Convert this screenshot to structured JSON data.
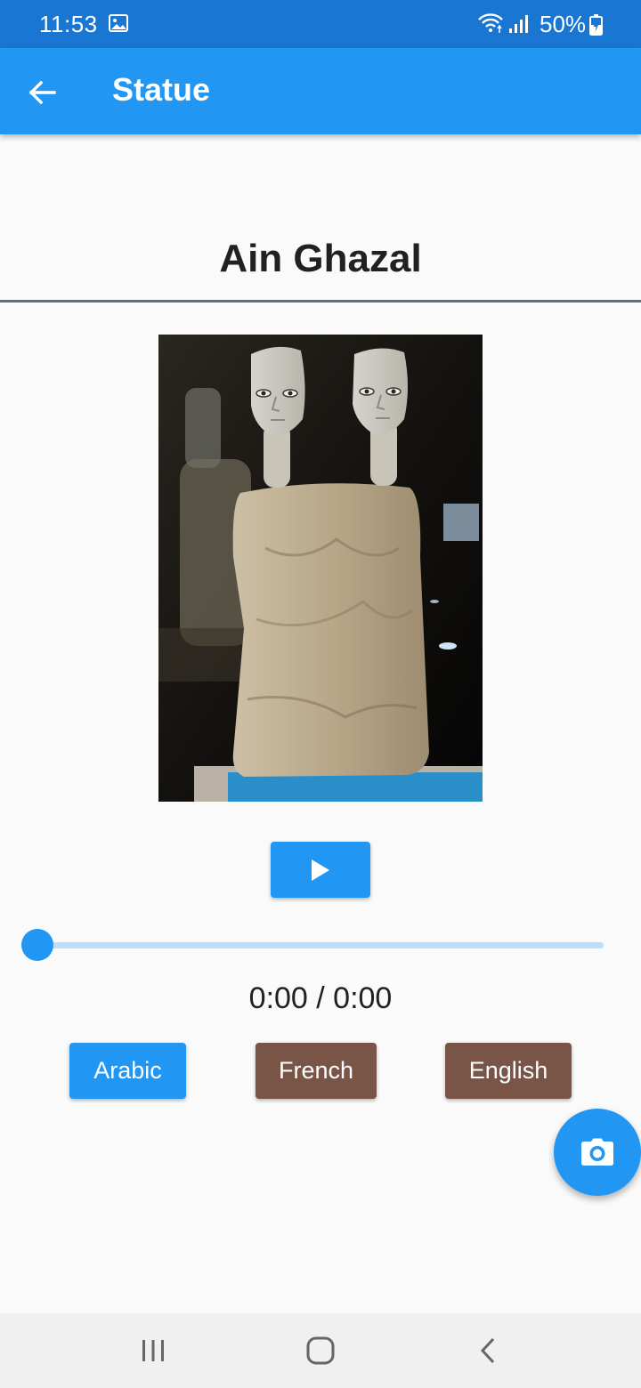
{
  "status_bar": {
    "time": "11:53",
    "battery": "50%"
  },
  "app_bar": {
    "title": "Statue",
    "back_icon": "arrow-left-icon"
  },
  "statue": {
    "name": "Ain Ghazal"
  },
  "player": {
    "play_icon": "play-icon",
    "time": "0:00 / 0:00",
    "progress": 0
  },
  "languages": [
    {
      "label": "Arabic",
      "selected": true
    },
    {
      "label": "French",
      "selected": false
    },
    {
      "label": "English",
      "selected": false
    }
  ],
  "fab": {
    "icon": "camera-icon"
  },
  "nav_bar": {
    "items": [
      "recents-icon",
      "home-icon",
      "back-icon"
    ]
  },
  "colors": {
    "primary": "#2196f3",
    "primary_dark": "#1976d2",
    "secondary": "#795548",
    "slider_track": "#bbdefb"
  }
}
